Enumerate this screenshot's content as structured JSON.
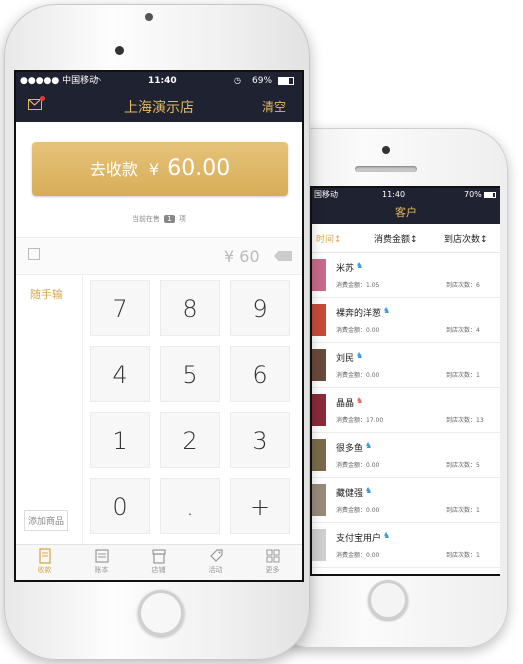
{
  "back_screen": {
    "status": {
      "carrier": "国移动",
      "time": "11:40",
      "battery": "70%"
    },
    "title": "客户",
    "sort": {
      "col1": "时间",
      "col2": "消费金额",
      "col3": "到店次数"
    },
    "customers": [
      {
        "name": "米苏",
        "spend": "消费金额：1.05",
        "visits": "到店次数：6",
        "person_color": "#3a9ad9",
        "thumb": "#c86a8a"
      },
      {
        "name": "裸奔的洋葱",
        "spend": "消费金额：0.00",
        "visits": "到店次数：4",
        "person_color": "#3a9ad9",
        "thumb": "#c84a3a"
      },
      {
        "name": "刘民",
        "spend": "消费金额：0.00",
        "visits": "到店次数：1",
        "person_color": "#3a9ad9",
        "thumb": "#6a4a3a"
      },
      {
        "name": "晶晶",
        "spend": "消费金额：17.00",
        "visits": "到店次数：13",
        "person_color": "#e06a6a",
        "thumb": "#8a2a3a"
      },
      {
        "name": "很多鱼",
        "spend": "消费金额：0.00",
        "visits": "到店次数：5",
        "person_color": "#3a9ad9",
        "thumb": "#7a6a4a"
      },
      {
        "name": "藏健强",
        "spend": "消费金额：0.00",
        "visits": "到店次数：1",
        "person_color": "#3a9ad9",
        "thumb": "#9a8a7a"
      },
      {
        "name": "支付宝用户",
        "spend": "消费金额：0.00",
        "visits": "到店次数：1",
        "person_color": "#3a9ad9",
        "thumb": "#cfcfcf"
      }
    ]
  },
  "front_screen": {
    "status": {
      "carrier": "●●●●● 中国移动",
      "time": "11:40",
      "battery": "69%"
    },
    "title": "上海演示店",
    "clear": "清空",
    "pay_button": {
      "label": "去收款",
      "currency": "¥",
      "amount": "60.00"
    },
    "on_sale": {
      "prefix": "当前在售",
      "count": "1",
      "suffix": "项"
    },
    "input_amount": "¥ 60",
    "quick_input": "随手输",
    "add_product": "添加商品",
    "keys": [
      "7",
      "8",
      "9",
      "4",
      "5",
      "6",
      "1",
      "2",
      "3",
      "0",
      ".",
      "+"
    ],
    "tabs": [
      {
        "label": "收款",
        "icon": "cash-register-icon",
        "active": true
      },
      {
        "label": "账本",
        "icon": "ledger-icon",
        "active": false
      },
      {
        "label": "店铺",
        "icon": "store-icon",
        "active": false
      },
      {
        "label": "活动",
        "icon": "tag-icon",
        "active": false
      },
      {
        "label": "更多",
        "icon": "grid-icon",
        "active": false
      }
    ]
  },
  "colors": {
    "nav_bg": "#1f2231",
    "gold": "#e0b861",
    "pay_button": "#d9b060",
    "tab_active": "#d8a848"
  }
}
